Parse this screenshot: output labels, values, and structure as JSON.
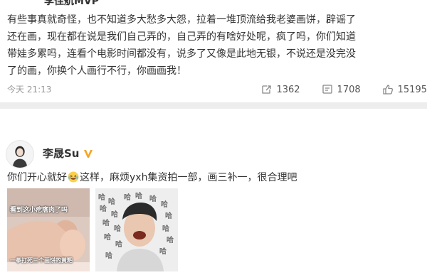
{
  "post1": {
    "author": "李佳航MVP",
    "lines": [
      "有些事真就奇怪，也不知道多大愁多大怨，拉着一堆顶流给我老婆画饼，辟谣了",
      "还在画，现在都在说是我们自己弄的，自己弄的有啥好处呢，疯了吗，你们知道",
      "带娃多累吗，连看个电影时间都没有，说多了又像是此地无银，不说还是没完没",
      "了的画，你换个人画行不行，你画画我！"
    ],
    "time": "今天 21:13",
    "repost_count": "1362",
    "comment_count": "1708",
    "like_count": "15195"
  },
  "post2": {
    "author": "李晟Su",
    "text_before": "你们开心就好",
    "text_after": "这样，麻烦yxh集资拍一部，画三补一，很合理吧",
    "image1": {
      "caption_top": "看到这小疙瘩肉了吗",
      "caption_bottom": "一拳打死三个画饼的黄粑"
    },
    "image2": {
      "overlay_char": "哈"
    }
  },
  "colors": {
    "vip_badge": "#f5a623",
    "meta_text": "#999999",
    "body_text": "#333333"
  }
}
